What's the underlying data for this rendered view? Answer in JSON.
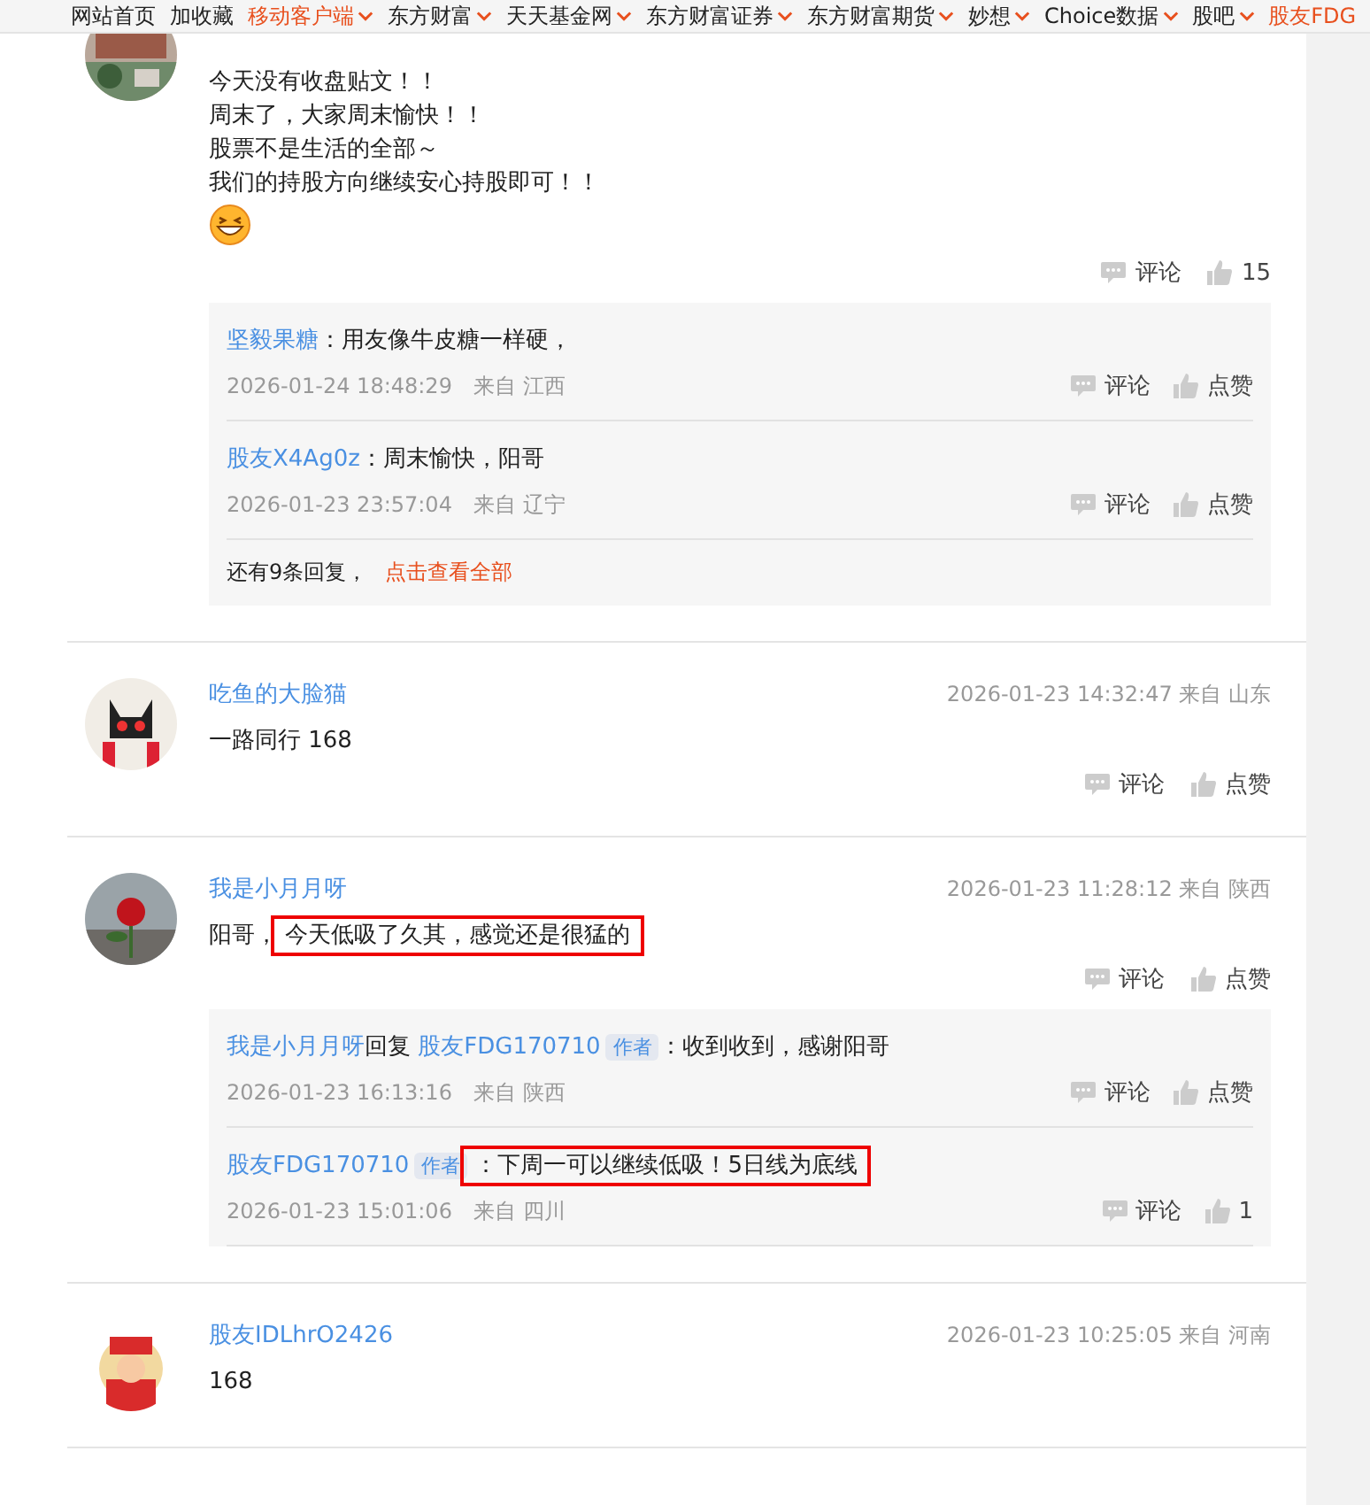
{
  "nav": [
    {
      "label": "网站首页",
      "accent": false,
      "dropdown": false
    },
    {
      "label": "加收藏",
      "accent": false,
      "dropdown": false
    },
    {
      "label": "移动客户端",
      "accent": true,
      "dropdown": true
    },
    {
      "label": "东方财富",
      "accent": false,
      "dropdown": true
    },
    {
      "label": "天天基金网",
      "accent": false,
      "dropdown": true
    },
    {
      "label": "东方财富证券",
      "accent": false,
      "dropdown": true
    },
    {
      "label": "东方财富期货",
      "accent": false,
      "dropdown": true
    },
    {
      "label": "妙想",
      "accent": false,
      "dropdown": true
    },
    {
      "label": "Choice数据",
      "accent": false,
      "dropdown": true
    },
    {
      "label": "股吧",
      "accent": false,
      "dropdown": true
    },
    {
      "label": "股友FDG",
      "accent": true,
      "dropdown": false
    }
  ],
  "comments": [
    {
      "body": [
        {
          "text": "今天没有收盘贴文！！",
          "highlighted": false
        }
      ],
      "extra_lines": [
        "周末了，大家周末愉快！！",
        "股票不是生活的全部～",
        "我们的持股方向继续安心持股即可！！"
      ],
      "emoji": true,
      "comment_label": "评论",
      "like_label": "15",
      "replies": [
        {
          "user": "坚毅果糖",
          "text": "：用友像牛皮糖一样硬，",
          "highlighted": false,
          "time": "2026-01-24 18:48:29",
          "location": "来自 江西",
          "comment_label": "评论",
          "like_label": "点赞"
        },
        {
          "user": "股友X4Ag0z",
          "text": "：周末愉快，阳哥",
          "highlighted": false,
          "time": "2026-01-23 23:57:04",
          "location": "来自 辽宁",
          "comment_label": "评论",
          "like_label": "点赞"
        }
      ],
      "more": {
        "text": "还有9条回复，",
        "link": "点击查看全部"
      }
    },
    {
      "author": "吃鱼的大脸猫",
      "time": "2026-01-23 14:32:47",
      "location": "来自 山东",
      "body": [
        {
          "text": "一路同行 168",
          "highlighted": false
        }
      ],
      "comment_label": "评论",
      "like_label": "点赞"
    },
    {
      "author": "我是小月月呀",
      "time": "2026-01-23 11:28:12",
      "location": "来自 陕西",
      "body": [
        {
          "text": "阳哥，",
          "highlighted": false
        },
        {
          "text": "今天低吸了久其，感觉还是很猛的",
          "highlighted": true
        }
      ],
      "comment_label": "评论",
      "like_label": "点赞",
      "replies": [
        {
          "user": "我是小月月呀",
          "reply_word": "回复",
          "reply_to": "股友FDG170710",
          "to_badge": "作者",
          "text": "：收到收到，感谢阳哥",
          "highlighted": false,
          "time": "2026-01-23 16:13:16",
          "location": "来自 陕西",
          "comment_label": "评论",
          "like_label": "点赞"
        },
        {
          "user": "股友FDG170710",
          "user_badge": "作者",
          "text": "：下周一可以继续低吸！5日线为底线",
          "highlighted": true,
          "time": "2026-01-23 15:01:06",
          "location": "来自 四川",
          "comment_label": "评论",
          "like_label": "1"
        }
      ]
    },
    {
      "author": "股友IDLhrO2426",
      "time": "2026-01-23 10:25:05",
      "location": "来自 河南",
      "body": [
        {
          "text": "168",
          "highlighted": false
        }
      ]
    }
  ]
}
